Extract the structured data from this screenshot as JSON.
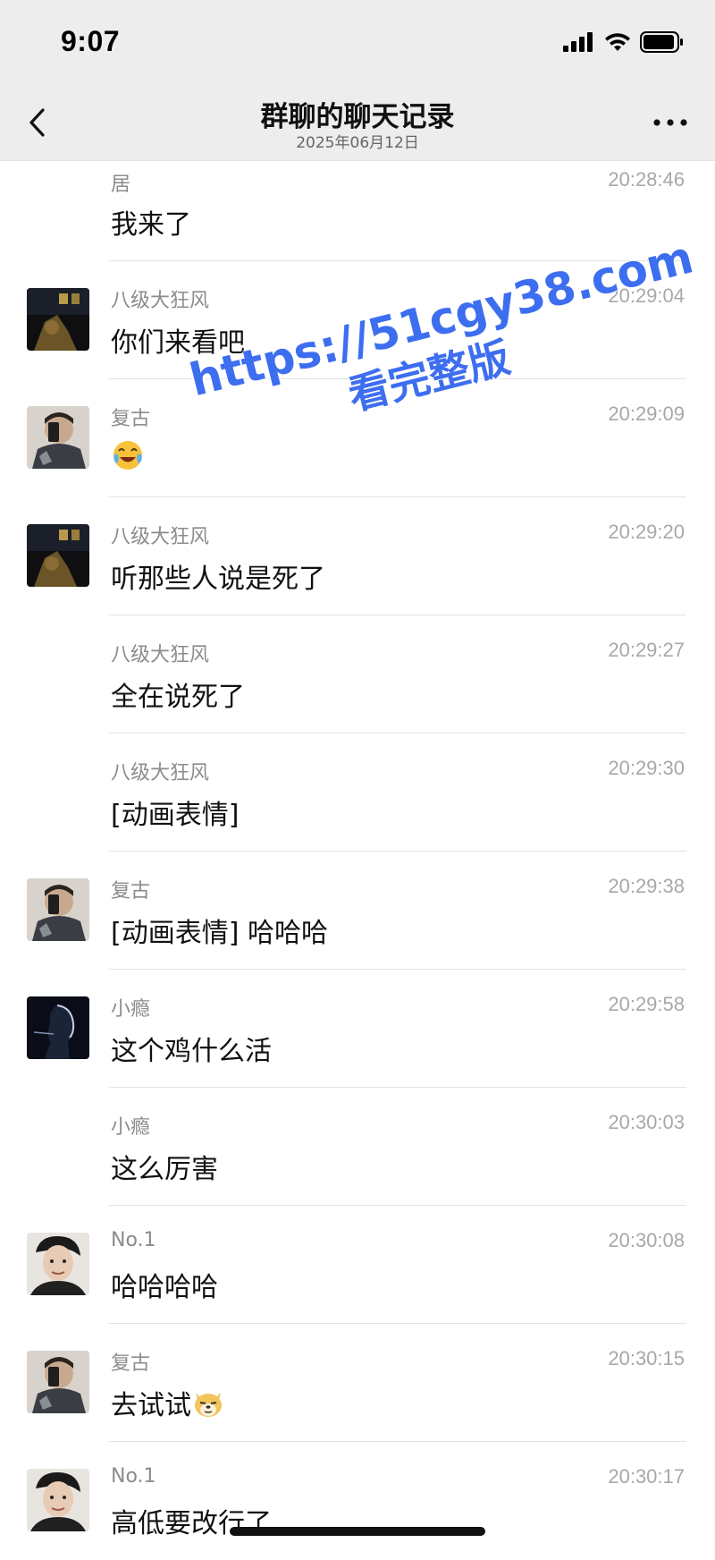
{
  "status": {
    "time": "9:07"
  },
  "nav": {
    "title": "群聊的聊天记录",
    "subtitle": "2025年06月12日"
  },
  "watermark": {
    "url": "https://51cgy38.com",
    "sub": "看完整版"
  },
  "messages": [
    {
      "name": "居",
      "time": "20:28:46",
      "text": "我来了",
      "avatar": null
    },
    {
      "name": "八级大狂风",
      "time": "20:29:04",
      "text": "你们来看吧",
      "avatar": "dark-room"
    },
    {
      "name": "复古",
      "time": "20:29:09",
      "text": "",
      "emoji": "crying-laughing-emoji",
      "avatar": "mirror-selfie"
    },
    {
      "name": "八级大狂风",
      "time": "20:29:20",
      "text": "听那些人说是死了",
      "avatar": "dark-room"
    },
    {
      "name": "八级大狂风",
      "time": "20:29:27",
      "text": "全在说死了",
      "avatar": null
    },
    {
      "name": "八级大狂风",
      "time": "20:29:30",
      "text": "[动画表情]",
      "avatar": null
    },
    {
      "name": "复古",
      "time": "20:29:38",
      "text": "[动画表情] 哈哈哈",
      "avatar": "mirror-selfie"
    },
    {
      "name": "小瘾",
      "time": "20:29:58",
      "text": "这个鸡什么活",
      "avatar": "silhouette"
    },
    {
      "name": "小瘾",
      "time": "20:30:03",
      "text": "这么厉害",
      "avatar": null
    },
    {
      "name": "No.1",
      "time": "20:30:08",
      "text": "哈哈哈哈",
      "avatar": "portrait"
    },
    {
      "name": "复古",
      "time": "20:30:15",
      "text": "去试试",
      "emoji": "doge-emoji",
      "avatar": "mirror-selfie"
    },
    {
      "name": "No.1",
      "time": "20:30:17",
      "text": "高低要改行了",
      "avatar": "portrait"
    }
  ],
  "colors": {
    "nav_bg": "#ededed",
    "watermark": "#3d6ef0",
    "timestamp": "#a8a8a8",
    "name": "#8c8c8c"
  }
}
